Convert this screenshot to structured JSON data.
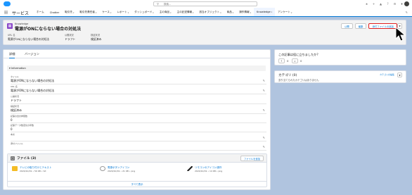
{
  "topbar": {
    "search_placeholder": "検索..."
  },
  "nav": {
    "app_name": "サービス",
    "tabs": [
      {
        "label": "ホーム",
        "has_menu": false
      },
      {
        "label": "Chatter",
        "has_menu": false
      },
      {
        "label": "取引先",
        "has_menu": true
      },
      {
        "label": "取引先責任者",
        "has_menu": true
      },
      {
        "label": "ケース",
        "has_menu": true
      },
      {
        "label": "レポート",
        "has_menu": true
      },
      {
        "label": "ダッシュボード",
        "has_menu": true
      },
      {
        "label": "主の商品",
        "has_menu": true
      },
      {
        "label": "主の記述情報",
        "has_menu": true
      },
      {
        "label": "該当オブジェクト",
        "has_menu": true
      },
      {
        "label": "商品",
        "has_menu": true
      },
      {
        "label": "操作情報",
        "has_menu": true
      },
      {
        "label": "Knowledge",
        "has_menu": true,
        "active": true
      },
      {
        "label": "アンケート",
        "has_menu": true
      }
    ]
  },
  "header": {
    "object_kind": "Knowledge",
    "title": "電源がONにならない場合の対処法",
    "fields": [
      {
        "label": "URL 名",
        "value": "電源がONにならない場合の対処法"
      },
      {
        "label": "公開状況",
        "value": "ドラフト"
      },
      {
        "label": "検証状況",
        "value": "検証済み"
      }
    ],
    "buttons": {
      "b1": "公開",
      "b2": "編集",
      "b3": "添付ファイルの追加"
    }
  },
  "detail": {
    "tabs": [
      "詳細",
      "バージョン"
    ],
    "section": "Information",
    "fields": [
      {
        "label": "タイトル",
        "value": "電源がONにならない場合の対処法"
      },
      {
        "label": "URL 名",
        "value": "電源がONにならない場合の対処法"
      },
      {
        "label": "公開状況",
        "value": "ドラフト"
      },
      {
        "label": "検証状況",
        "value": "検証済み"
      },
      {
        "label": "記事の合計参照数",
        "value": "0"
      },
      {
        "label": "記事データ数変化の年数",
        "value": "0"
      },
      {
        "label": "本文",
        "value": ""
      },
      {
        "label": "添付ファイル",
        "value": ""
      }
    ]
  },
  "files": {
    "title": "ファイル (3)",
    "upload_button": "ファイルを追加",
    "items": [
      {
        "name": "テレビの取り付けとテキスト",
        "meta": "2024/10/19 • 59 KB • txt"
      },
      {
        "name": "電源ボタンアイコン",
        "meta": "2024/10/19 • 21 KB • png"
      },
      {
        "name": "リモコンのアイコン操作",
        "meta": "2024/10/19 • 14 KB • png"
      }
    ],
    "view_all": "すべて表示"
  },
  "vote": {
    "question": "この記事は役に立ちましたか?",
    "up_count": "0",
    "down_count": "0"
  },
  "categories": {
    "title": "カテゴリ (0)",
    "description": "割り当てられたカテゴリはありません",
    "link": "カテゴリの編集"
  },
  "colors": {
    "brand": "#0176d3",
    "highlight": "#e02020",
    "background": "#b0c4df"
  }
}
